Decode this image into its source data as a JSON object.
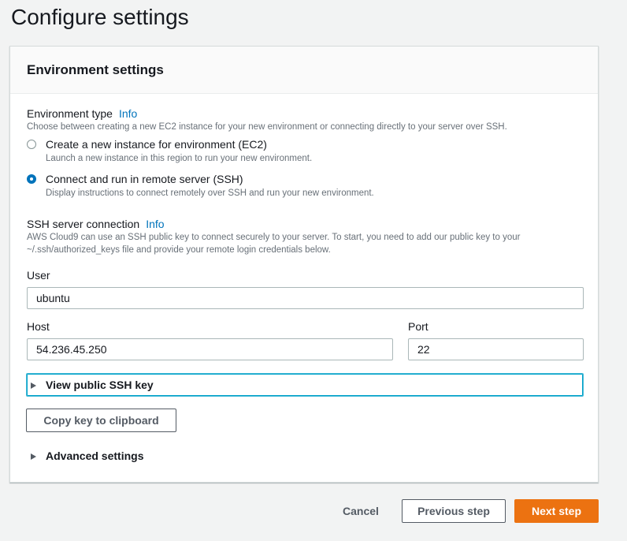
{
  "page": {
    "title": "Configure settings"
  },
  "panel": {
    "title": "Environment settings"
  },
  "environment_type": {
    "label": "Environment type",
    "info": "Info",
    "description": "Choose between creating a new EC2 instance for your new environment or connecting directly to your server over SSH.",
    "options": [
      {
        "label": "Create a new instance for environment (EC2)",
        "description": "Launch a new instance in this region to run your new environment.",
        "selected": false
      },
      {
        "label": "Connect and run in remote server (SSH)",
        "description": "Display instructions to connect remotely over SSH and run your new environment.",
        "selected": true
      }
    ]
  },
  "ssh": {
    "label": "SSH server connection",
    "info": "Info",
    "description_line1": "AWS Cloud9 can use an SSH public key to connect securely to your server. To start, you need to add our public key to your",
    "description_line2": "~/.ssh/authorized_keys file and provide your remote login credentials below.",
    "user_label": "User",
    "user_value": "ubuntu",
    "host_label": "Host",
    "host_value": "54.236.45.250",
    "port_label": "Port",
    "port_value": "22",
    "view_key_label": "View public SSH key",
    "copy_key_label": "Copy key to clipboard",
    "advanced_label": "Advanced settings"
  },
  "footer": {
    "cancel_label": "Cancel",
    "previous_label": "Previous step",
    "next_label": "Next step"
  },
  "colors": {
    "accent": "#0073bb",
    "primary_button": "#ec7211",
    "focus_border": "#00a1c9"
  },
  "icons": {
    "expander": "caret-right-icon",
    "radio": "radio-icon"
  }
}
